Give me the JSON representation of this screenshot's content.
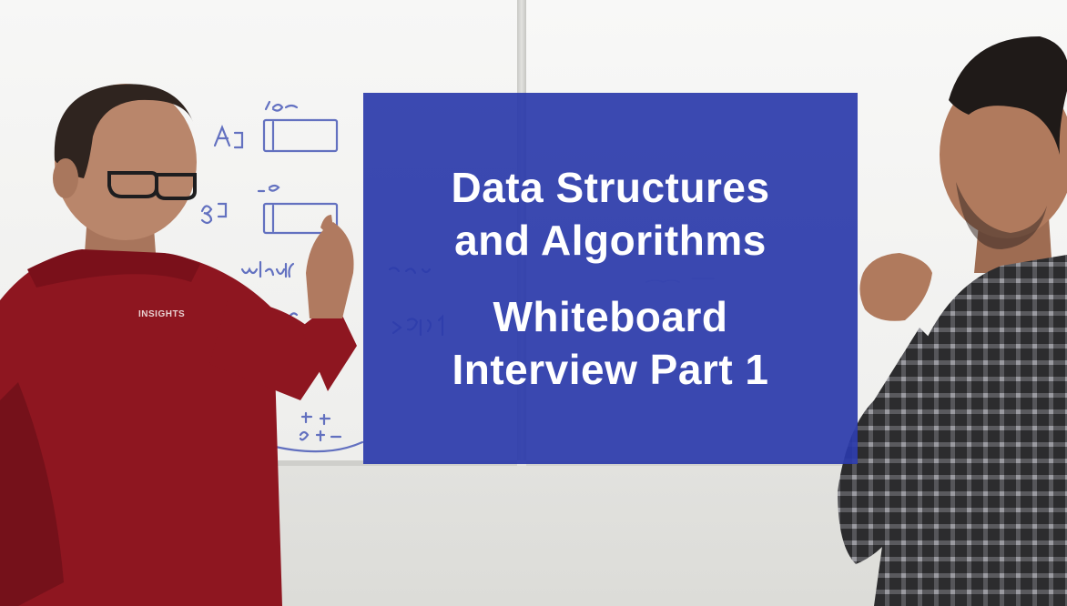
{
  "overlay": {
    "title_line_1": "Data Structures",
    "title_line_2": "and Algorithms",
    "subtitle_line_1": "Whiteboard",
    "subtitle_line_2": "Interview Part 1",
    "background_color": "#2a3aaa",
    "text_color": "#ffffff"
  },
  "shirt_logo": "INSIGHTS"
}
